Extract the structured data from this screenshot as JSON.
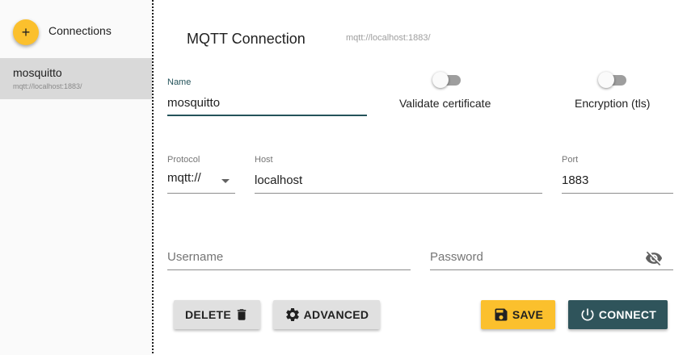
{
  "sidebar": {
    "add_icon": "+",
    "title": "Connections",
    "items": [
      {
        "name": "mosquitto",
        "url": "mqtt://localhost:1883/"
      }
    ]
  },
  "main": {
    "title": "MQTT Connection",
    "subtitle": "mqtt://localhost:1883/",
    "name_field": {
      "label": "Name",
      "value": "mosquitto"
    },
    "validate_certificate": {
      "label": "Validate certificate",
      "checked": false
    },
    "encryption": {
      "label": "Encryption (tls)",
      "checked": false
    },
    "protocol": {
      "label": "Protocol",
      "value": "mqtt://"
    },
    "host": {
      "label": "Host",
      "value": "localhost"
    },
    "port": {
      "label": "Port",
      "value": "1883"
    },
    "username": {
      "placeholder": "Username",
      "value": ""
    },
    "password": {
      "placeholder": "Password",
      "value": ""
    }
  },
  "buttons": {
    "delete": "DELETE",
    "advanced": "ADVANCED",
    "save": "SAVE",
    "connect": "CONNECT"
  },
  "colors": {
    "accent": "#fbc02d",
    "primary": "#2f545b",
    "selected_item": "#d9d9d9"
  },
  "icons": {
    "add": "plus-icon",
    "delete": "trash-icon",
    "advanced": "gear-icon",
    "save": "floppy-disk-icon",
    "connect": "power-icon",
    "password_visibility": "eye-off-icon",
    "protocol_dropdown": "caret-down-icon"
  }
}
